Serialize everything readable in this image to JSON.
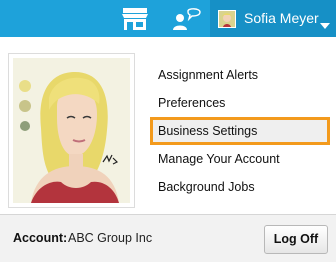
{
  "header": {
    "user_name": "Sofia Meyer",
    "icons": [
      "store-icon",
      "chat-icon",
      "chevron-down-icon"
    ],
    "bar_color": "#1ea2da",
    "user_menu_color": "#1690c6"
  },
  "menu": {
    "items": [
      {
        "label": "Assignment Alerts"
      },
      {
        "label": "Preferences"
      },
      {
        "label": "Business Settings"
      },
      {
        "label": "Manage Your Account"
      },
      {
        "label": "Background Jobs"
      }
    ],
    "highlight_color": "#f39a1c"
  },
  "footer": {
    "account_label": "Account:",
    "account_value": "ABC Group Inc",
    "logoff_label": "Log Off"
  }
}
